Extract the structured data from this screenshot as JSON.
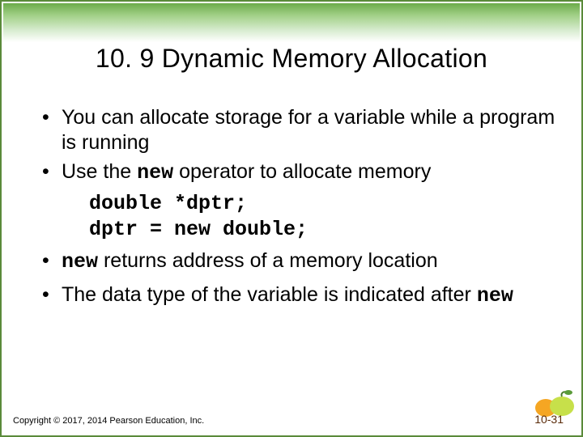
{
  "slide": {
    "title": "10. 9  Dynamic Memory Allocation",
    "bullet1": "You can allocate storage for a variable while a program is running",
    "bullet2_pre": "Use the ",
    "bullet2_code": "new",
    "bullet2_post": " operator to allocate memory",
    "code_line1": "double *dptr;",
    "code_line2": "dptr = new double;",
    "bullet3_code": "new",
    "bullet3_post": " returns address of a memory location",
    "bullet4_pre": "The data type of the variable is indicated after ",
    "bullet4_code": "new",
    "footer": "Copyright © 2017, 2014 Pearson Education, Inc.",
    "pagenum": "10-31"
  }
}
